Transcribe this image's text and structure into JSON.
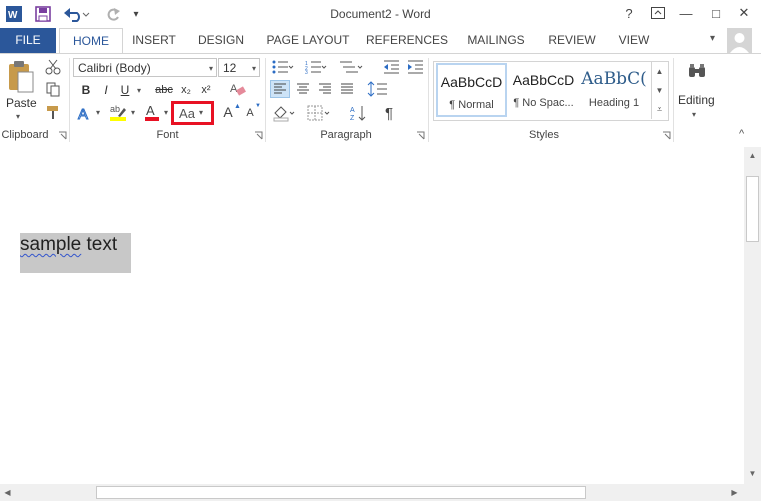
{
  "app": {
    "title": "Document2 - Word",
    "title_bar_buttons": {
      "help": "?",
      "minimize": "—",
      "maximize": "□",
      "close": "✕"
    }
  },
  "tabs": [
    "FILE",
    "HOME",
    "INSERT",
    "DESIGN",
    "PAGE LAYOUT",
    "REFERENCES",
    "MAILINGS",
    "REVIEW",
    "VIEW"
  ],
  "ribbon": {
    "clipboard": {
      "label": "Clipboard",
      "paste_label": "Paste"
    },
    "font": {
      "label": "Font",
      "font_name": "Calibri (Body)",
      "font_size": "12",
      "bold": "B",
      "italic": "I",
      "underline": "U",
      "strikethrough": "abc",
      "subscript": "x₂",
      "superscript": "x²",
      "change_case": "Aa",
      "grow": "A",
      "shrink": "A"
    },
    "paragraph": {
      "label": "Paragraph",
      "show_marks": "¶"
    },
    "styles": {
      "label": "Styles",
      "items": [
        {
          "sample": "AaBbCcD",
          "name": "¶ Normal"
        },
        {
          "sample": "AaBbCcD",
          "name": "¶ No Spac..."
        },
        {
          "sample": "AaBbC(",
          "name": "Heading 1"
        }
      ]
    },
    "editing": {
      "label": "Editing"
    }
  },
  "document": {
    "text_word1": "sample",
    "text_word2": " text"
  },
  "colors": {
    "file_tab": "#2b579a",
    "highlight_box": "#e81123",
    "selection": "#c8c8c8",
    "font_red": "#e81123",
    "highlight_yellow": "#ffff00"
  }
}
